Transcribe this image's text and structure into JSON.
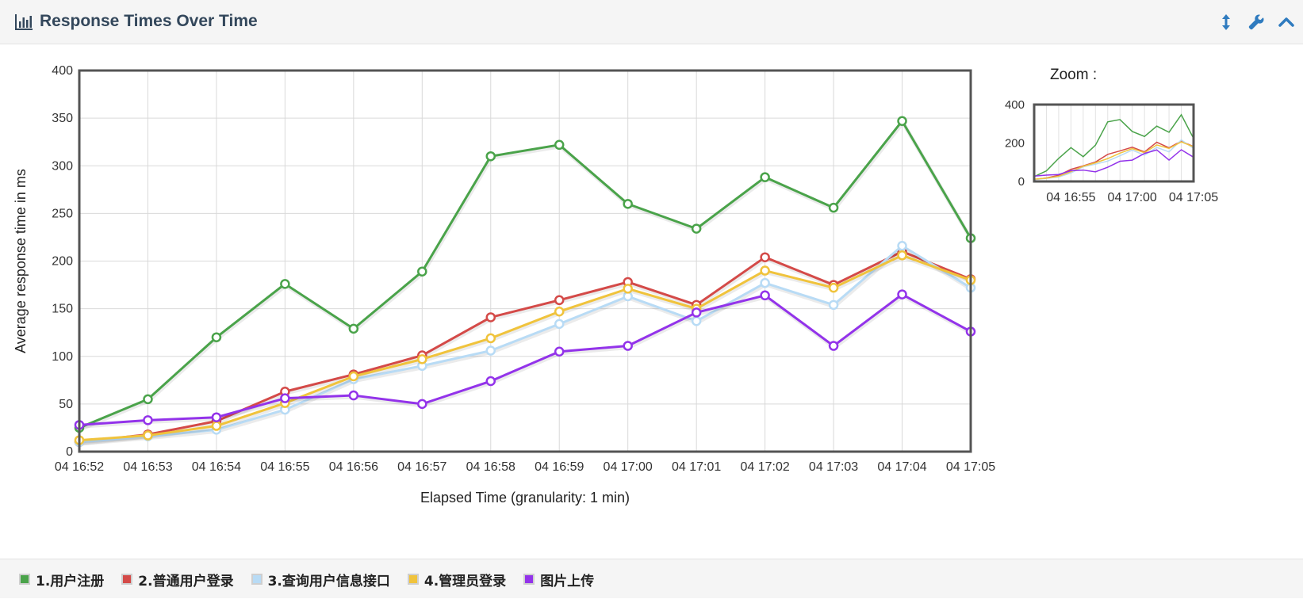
{
  "panel": {
    "title": "Response Times Over Time",
    "icons": [
      "bar-chart-icon",
      "resize-vertical-icon",
      "wrench-icon",
      "chevron-up-icon"
    ]
  },
  "zoom": {
    "label": "Zoom :"
  },
  "chart_data": {
    "type": "line",
    "title": "",
    "xlabel": "Elapsed Time (granularity: 1 min)",
    "ylabel": "Average response time in ms",
    "ylim": [
      0,
      400
    ],
    "yticks": [
      0,
      50,
      100,
      150,
      200,
      250,
      300,
      350,
      400
    ],
    "grid": true,
    "legend_position": "bottom",
    "categories": [
      "04 16:52",
      "04 16:53",
      "04 16:54",
      "04 16:55",
      "04 16:56",
      "04 16:57",
      "04 16:58",
      "04 16:59",
      "04 17:00",
      "04 17:01",
      "04 17:02",
      "04 17:03",
      "04 17:04",
      "04 17:05"
    ],
    "series": [
      {
        "name": "1.用户注册",
        "color": "#4aa34a",
        "values": [
          25,
          55,
          120,
          176,
          129,
          189,
          310,
          322,
          260,
          234,
          288,
          256,
          347,
          224
        ]
      },
      {
        "name": "2.普通用户登录",
        "color": "#d44a48",
        "values": [
          10,
          18,
          32,
          63,
          81,
          101,
          141,
          159,
          178,
          154,
          204,
          175,
          210,
          181
        ]
      },
      {
        "name": "3.查询用户信息接口",
        "color": "#b8dbf5",
        "values": [
          10,
          16,
          23,
          44,
          76,
          90,
          106,
          134,
          163,
          137,
          177,
          154,
          216,
          172
        ]
      },
      {
        "name": "4.管理员登录",
        "color": "#f0c33c",
        "values": [
          12,
          17,
          27,
          51,
          79,
          97,
          119,
          147,
          171,
          150,
          190,
          172,
          206,
          180
        ]
      },
      {
        "name": "图片上传",
        "color": "#9333ea",
        "values": [
          28,
          33,
          36,
          56,
          59,
          50,
          74,
          105,
          111,
          146,
          164,
          111,
          165,
          126
        ]
      }
    ]
  },
  "zoom_chart": {
    "yticks": [
      0,
      200,
      400
    ],
    "xticks": [
      "04 16:55",
      "04 17:00",
      "04 17:05"
    ]
  }
}
